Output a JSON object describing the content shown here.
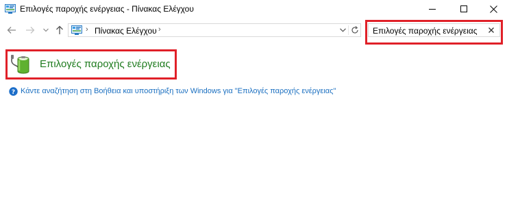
{
  "window": {
    "title": "Επιλογές παροχής ενέργειας - Πίνακας Ελέγχου",
    "minimize_glyph": "–",
    "maximize_glyph": "☐",
    "close_glyph": "✕"
  },
  "navigation": {
    "breadcrumb_root": "Πίνακας Ελέγχου",
    "breadcrumb_separator": "›"
  },
  "search": {
    "value": "Επιλογές παροχής ενέργειας",
    "clear_glyph": "✕"
  },
  "results": {
    "items": [
      {
        "label": "Επιλογές παροχής ενέργειας",
        "icon": "power-options-icon"
      }
    ],
    "help_link": "Κάντε αναζήτηση στη Βοήθεια και υποστήριξη των Windows για \"Επιλογές παροχής ενέργειας\""
  },
  "colors": {
    "highlight": "#e02028",
    "result_link": "#1e7b1e",
    "help_link": "#1a6fc0"
  }
}
